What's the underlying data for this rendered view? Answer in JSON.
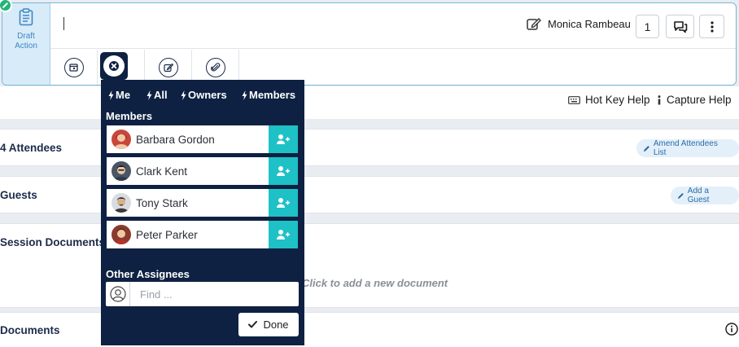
{
  "action": {
    "draft_label_line1": "Draft",
    "draft_label_line2": "Action",
    "owner_name": "Monica Rambeau",
    "count": "1"
  },
  "help": {
    "hotkey_label": "Hot Key Help",
    "capture_label": "Capture Help"
  },
  "sections": {
    "attendees_title": "4 Attendees",
    "amend_label": "Amend Attendees List",
    "guests_title": "Guests",
    "add_guest_label": "Add a Guest",
    "session_docs_title": "Session Documents",
    "drop_text": "Click to add a new document",
    "documents_title": "Documents"
  },
  "dropdown": {
    "quick_filters": [
      "Me",
      "All",
      "Owners",
      "Members"
    ],
    "members_heading": "Members",
    "members": [
      {
        "name": "Barbara Gordon",
        "avatar_color": "#c7473b"
      },
      {
        "name": "Clark Kent",
        "avatar_color": "#4b5563"
      },
      {
        "name": "Tony Stark",
        "avatar_color": "#6b5b4e"
      },
      {
        "name": "Peter Parker",
        "avatar_color": "#8a3b2e"
      }
    ],
    "other_heading": "Other Assignees",
    "find_placeholder": "Find ...",
    "done_label": "Done"
  },
  "colors": {
    "navy": "#0e2142",
    "teal": "#1ec1c6",
    "draft_bg": "#d8ebf8",
    "badge_green": "#22b57a"
  },
  "icons": {
    "draft": "clipboard-icon",
    "badge": "pencil-icon",
    "owner": "edit-icon",
    "comments": "chat-icon",
    "menu": "kebab-icon",
    "tools": [
      "calendar-icon",
      "close-icon",
      "edit-icon",
      "attach-icon"
    ],
    "quick": "bolt-icon",
    "add_member": "user-plus-icon",
    "find": "user-icon",
    "done": "check-icon",
    "hotkey": "keyboard-icon",
    "capture": "info-icon"
  }
}
